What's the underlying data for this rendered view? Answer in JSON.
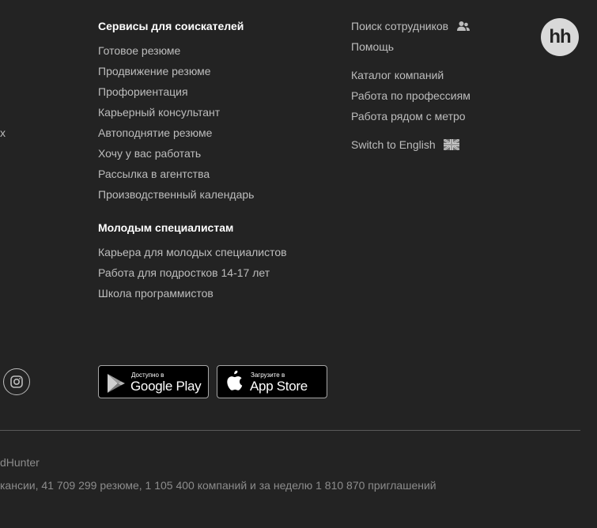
{
  "services": {
    "heading": "Сервисы для соискателей",
    "links": [
      {
        "label": "Готовое резюме"
      },
      {
        "label": "Продвижение резюме"
      },
      {
        "label": "Профориентация"
      },
      {
        "label": "Карьерный консультант"
      },
      {
        "label": "Автоподнятие резюме"
      },
      {
        "label": "Хочу у вас работать"
      },
      {
        "label": "Рассылка в агентства"
      },
      {
        "label": "Производственный календарь"
      }
    ]
  },
  "young": {
    "heading": "Молодым специалистам",
    "links": [
      {
        "label": "Карьера для молодых специалистов"
      },
      {
        "label": "Работа для подростков 14-17 лет"
      },
      {
        "label": "Школа программистов"
      }
    ]
  },
  "right_column": {
    "group1": [
      {
        "label": "Поиск сотрудников",
        "icon": "users-icon"
      },
      {
        "label": "Помощь"
      }
    ],
    "group2": [
      {
        "label": "Каталог компаний"
      },
      {
        "label": "Работа по профессиям"
      },
      {
        "label": "Работа рядом с метро"
      }
    ],
    "language": {
      "label": "Switch to English",
      "icon": "uk-flag-icon"
    }
  },
  "logo": {
    "text": "hh"
  },
  "left_fragment": {
    "text": "х"
  },
  "social": {
    "icon": "instagram-icon"
  },
  "app_badges": {
    "google_play": {
      "small": "Доступно в",
      "big": "Google Play"
    },
    "app_store": {
      "small": "Загрузите в",
      "big": "App Store"
    }
  },
  "footer": {
    "copyright": "dHunter",
    "stats": "кансии, 41 709 299 резюме, 1 105 400 компаний и за неделю 1 810 870 приглашений"
  },
  "colors": {
    "background": "#232323",
    "link": "#bdbdbd",
    "heading": "#ffffff",
    "muted": "#8c8c8c",
    "logo_bg": "#d9d9d9"
  }
}
